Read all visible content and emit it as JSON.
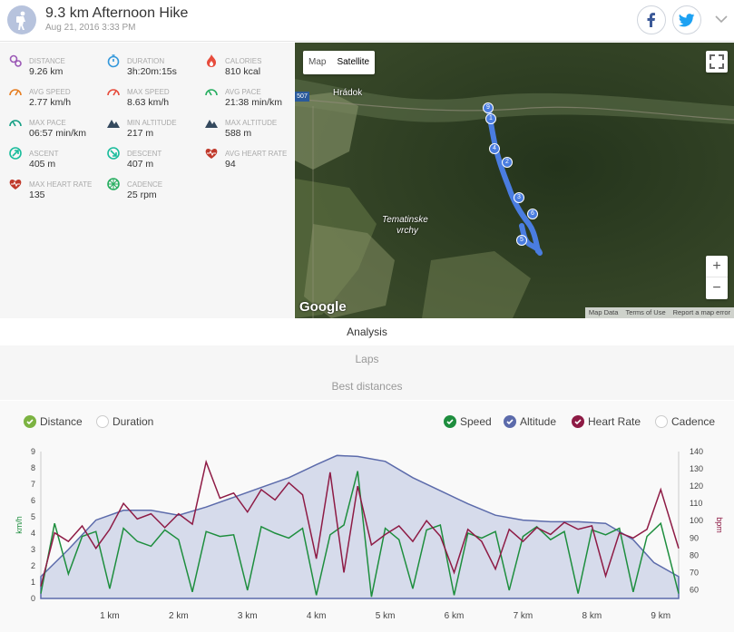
{
  "header": {
    "title": "9.3 km Afternoon Hike",
    "date": "Aug 21, 2016 3:33 PM"
  },
  "stats": [
    {
      "label": "DISTANCE",
      "value": "9.26 km",
      "icon": "distance-pin-icon",
      "color": "#9b59b6"
    },
    {
      "label": "DURATION",
      "value": "3h:20m:15s",
      "icon": "stopwatch-icon",
      "color": "#3498db"
    },
    {
      "label": "CALORIES",
      "value": "810 kcal",
      "icon": "flame-icon",
      "color": "#e74c3c"
    },
    {
      "label": "AVG SPEED",
      "value": "2.77 km/h",
      "icon": "speedometer-icon",
      "color": "#e67e22"
    },
    {
      "label": "MAX SPEED",
      "value": "8.63 km/h",
      "icon": "speedometer-icon",
      "color": "#e74c3c"
    },
    {
      "label": "AVG PACE",
      "value": "21:38 min/km",
      "icon": "gauge-icon",
      "color": "#27ae60"
    },
    {
      "label": "MAX PACE",
      "value": "06:57 min/km",
      "icon": "gauge-icon",
      "color": "#16a085"
    },
    {
      "label": "MIN ALTITUDE",
      "value": "217 m",
      "icon": "mountain-icon",
      "color": "#34495e"
    },
    {
      "label": "MAX ALTITUDE",
      "value": "588 m",
      "icon": "mountain-icon",
      "color": "#34495e"
    },
    {
      "label": "ASCENT",
      "value": "405 m",
      "icon": "compass-up-icon",
      "color": "#1abc9c"
    },
    {
      "label": "DESCENT",
      "value": "407 m",
      "icon": "compass-down-icon",
      "color": "#1abc9c"
    },
    {
      "label": "AVG HEART RATE",
      "value": "94",
      "icon": "heart-icon",
      "color": "#c0392b"
    },
    {
      "label": "MAX HEART RATE",
      "value": "135",
      "icon": "heart-icon",
      "color": "#c0392b"
    },
    {
      "label": "CADENCE",
      "value": "25 rpm",
      "icon": "cadence-icon",
      "color": "#27ae60"
    }
  ],
  "map": {
    "toggle_map": "Map",
    "toggle_satellite": "Satellite",
    "place_hradok": "Hrádok",
    "place_tematinske_1": "Tematinske",
    "place_tematinske_2": "vrchy",
    "road": "507",
    "logo": "Google",
    "zoom_in": "+",
    "zoom_out": "−",
    "footer": [
      "Map Data",
      "Terms of Use",
      "Report a map error"
    ],
    "markers": [
      "9",
      "1",
      "4",
      "2",
      "3",
      "6",
      "5"
    ]
  },
  "tabs": [
    {
      "label": "Analysis",
      "active": true
    },
    {
      "label": "Laps",
      "active": false
    },
    {
      "label": "Best distances",
      "active": false
    }
  ],
  "legend": {
    "distance": {
      "label": "Distance",
      "checked": true,
      "color": "#7cb342"
    },
    "duration": {
      "label": "Duration",
      "checked": false
    },
    "speed": {
      "label": "Speed",
      "checked": true,
      "color": "#1e8e3e"
    },
    "altitude": {
      "label": "Altitude",
      "checked": true,
      "color": "#5c6bab"
    },
    "heart_rate": {
      "label": "Heart Rate",
      "checked": true,
      "color": "#8e1b45"
    },
    "cadence": {
      "label": "Cadence",
      "checked": false
    }
  },
  "chart_data": {
    "type": "line",
    "xlabel": "",
    "x_ticks": [
      "1 km",
      "2 km",
      "3 km",
      "4 km",
      "5 km",
      "6 km",
      "7 km",
      "8 km",
      "9 km"
    ],
    "x_range": [
      0,
      9.26
    ],
    "y_left": {
      "label": "km/h",
      "ticks": [
        "0",
        "1",
        "2",
        "3",
        "4",
        "5",
        "6",
        "7",
        "8",
        "9"
      ],
      "range": [
        0,
        9
      ]
    },
    "y_right": {
      "label": "bpm",
      "ticks": [
        "60",
        "70",
        "80",
        "90",
        "100",
        "110",
        "120",
        "130",
        "140"
      ],
      "range": [
        55,
        140
      ]
    },
    "series": [
      {
        "name": "Altitude",
        "axis": "hidden",
        "x": [
          0,
          0.4,
          0.8,
          1.2,
          1.6,
          2.0,
          2.4,
          2.8,
          3.2,
          3.6,
          4.0,
          4.3,
          4.6,
          5.0,
          5.4,
          5.8,
          6.2,
          6.6,
          7.0,
          7.4,
          7.8,
          8.2,
          8.6,
          8.9,
          9.26
        ],
        "values": [
          217,
          300,
          390,
          420,
          420,
          405,
          430,
          460,
          490,
          520,
          560,
          588,
          585,
          570,
          520,
          480,
          440,
          405,
          390,
          385,
          385,
          380,
          330,
          260,
          217
        ]
      },
      {
        "name": "Speed",
        "axis": "left",
        "x": [
          0.0,
          0.2,
          0.4,
          0.6,
          0.8,
          1.0,
          1.2,
          1.4,
          1.6,
          1.8,
          2.0,
          2.2,
          2.4,
          2.6,
          2.8,
          3.0,
          3.2,
          3.4,
          3.6,
          3.8,
          4.0,
          4.2,
          4.4,
          4.6,
          4.8,
          5.0,
          5.2,
          5.4,
          5.6,
          5.8,
          6.0,
          6.2,
          6.4,
          6.6,
          6.8,
          7.0,
          7.2,
          7.4,
          7.6,
          7.8,
          8.0,
          8.2,
          8.4,
          8.6,
          8.8,
          9.0,
          9.26
        ],
        "values": [
          0.3,
          4.6,
          1.5,
          3.8,
          4.1,
          0.6,
          4.3,
          3.5,
          3.2,
          4.2,
          3.6,
          0.4,
          4.1,
          3.8,
          3.9,
          0.5,
          4.4,
          4.0,
          3.7,
          4.3,
          0.2,
          3.9,
          4.5,
          7.8,
          0.1,
          4.3,
          3.6,
          0.6,
          4.2,
          4.5,
          0.2,
          4.0,
          3.7,
          4.1,
          0.5,
          3.8,
          4.4,
          3.6,
          4.1,
          0.3,
          4.2,
          3.9,
          4.3,
          0.4,
          3.8,
          4.6,
          0.3
        ]
      },
      {
        "name": "Heart Rate",
        "axis": "right",
        "x": [
          0.0,
          0.2,
          0.4,
          0.6,
          0.8,
          1.0,
          1.2,
          1.4,
          1.6,
          1.8,
          2.0,
          2.2,
          2.4,
          2.6,
          2.8,
          3.0,
          3.2,
          3.4,
          3.6,
          3.8,
          4.0,
          4.2,
          4.4,
          4.6,
          4.8,
          5.0,
          5.2,
          5.4,
          5.6,
          5.8,
          6.0,
          6.2,
          6.4,
          6.6,
          6.8,
          7.0,
          7.2,
          7.4,
          7.6,
          7.8,
          8.0,
          8.2,
          8.4,
          8.6,
          8.8,
          9.0,
          9.26
        ],
        "values": [
          62,
          93,
          88,
          97,
          84,
          95,
          110,
          101,
          104,
          96,
          104,
          98,
          134,
          113,
          116,
          105,
          118,
          112,
          122,
          115,
          78,
          128,
          70,
          120,
          86,
          92,
          97,
          88,
          100,
          91,
          70,
          95,
          88,
          72,
          95,
          88,
          96,
          92,
          99,
          95,
          97,
          68,
          93,
          90,
          95,
          118,
          84
        ]
      }
    ]
  }
}
